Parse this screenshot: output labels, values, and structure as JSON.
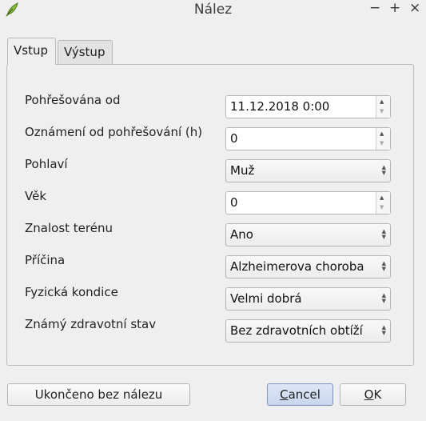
{
  "window": {
    "title": "Nález",
    "controls": {
      "minimize": "−",
      "maximize": "+",
      "close": "×"
    }
  },
  "tabs": [
    {
      "label": "Vstup",
      "active": true
    },
    {
      "label": "Výstup",
      "active": false
    }
  ],
  "form": {
    "fields": [
      {
        "label": "Pohřešována od",
        "value": "11.12.2018 0:00",
        "type": "datetime-spin"
      },
      {
        "label": "Oznámení od pohřešování (h)",
        "value": "0",
        "type": "spin"
      },
      {
        "label": "Pohlaví",
        "value": "Muž",
        "type": "combo"
      },
      {
        "label": "Věk",
        "value": "0",
        "type": "spin"
      },
      {
        "label": "Znalost terénu",
        "value": "Ano",
        "type": "combo"
      },
      {
        "label": "Příčina",
        "value": "Alzheimerova choroba",
        "type": "combo"
      },
      {
        "label": "Fyzická kondice",
        "value": "Velmi dobrá",
        "type": "combo"
      },
      {
        "label": "Známý zdravotní stav",
        "value": "Bez zdravotních obtíží",
        "type": "combo"
      }
    ]
  },
  "buttons": {
    "finish": "Ukončeno bez nálezu",
    "cancel_mnemonic": "C",
    "cancel_rest": "ancel",
    "ok_mnemonic": "O",
    "ok_rest": "K"
  },
  "icons": {
    "app": "qgis-leaf-icon",
    "spin_up": "▲",
    "spin_down": "▼"
  },
  "colors": {
    "background": "#efefef",
    "default_button": "#c9d6ee"
  }
}
